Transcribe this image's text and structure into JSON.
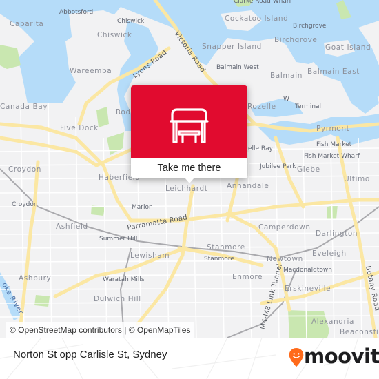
{
  "map": {
    "colors": {
      "land": "#f2f2f3",
      "water": "#b5dcf9",
      "park": "#c9e7b0",
      "major_road": "#fbe7a3",
      "minor_road": "#ffffff",
      "rail": "#a9a9ad"
    },
    "suburb_labels": [
      "Cabarita",
      "Chiswick",
      "Wareemba",
      "Canada Bay",
      "Rod",
      "Five Dock",
      "Croydon",
      "Haberfield",
      "Leichhardt",
      "Annandale",
      "Ashfield",
      "Lewisham",
      "Ashbury",
      "Dulwich Hill",
      "Stanmore",
      "Enmore",
      "Newtown",
      "Erskineville",
      "Camperdown",
      "Darlington",
      "Eveleigh",
      "Alexandria",
      "Beaconsfie",
      "Cockatoo Island",
      "Birchgrove",
      "Snapper Island",
      "Goat Island",
      "Balmain",
      "Balmain East",
      "Rozelle",
      "Pyrmont",
      "Glebe",
      "Ultimo"
    ],
    "poi_labels": [
      "Abbotsford",
      "Chiswick",
      "Clarke Road Wharf",
      "Birchgrove",
      "Balmain West",
      "White Bay Cruise Terminal",
      "Fish Market",
      "Fish Market Wharf",
      "Jubilee Park",
      "elle Bay",
      "Croydon",
      "Marion",
      "Summer Hill",
      "Waratah Mills",
      "Stanmore",
      "Macdonaldtown"
    ],
    "road_labels": [
      "Lyons Road",
      "Victoria Road",
      "Parramatta Road",
      "M4-M8 Link Tunnel",
      "Botany Road"
    ],
    "water_labels": [
      "oks River"
    ]
  },
  "popup": {
    "icon": "bus-stop-shelter-icon",
    "action_label": "Take me there",
    "accent_color": "#e10b2f"
  },
  "attribution": "© OpenStreetMap contributors | © OpenMapTiles",
  "footer": {
    "stop_name": "Norton St opp Carlisle St, Sydney",
    "brand": "moovit",
    "brand_color": "#ff6a1a"
  }
}
